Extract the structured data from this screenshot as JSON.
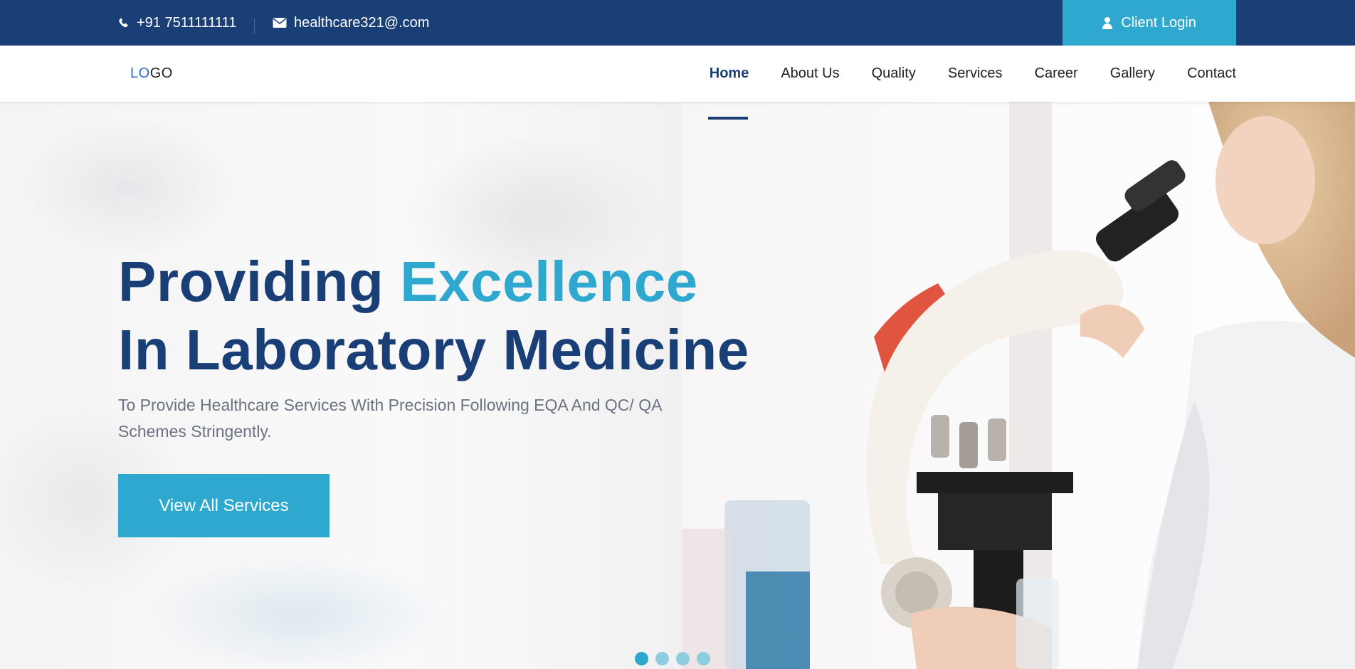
{
  "topbar": {
    "phone": "+91 7511111111",
    "email": "healthcare321@.com",
    "login_label": "Client Login"
  },
  "nav": {
    "logo_part1": "LO",
    "logo_part2": "GO",
    "items": [
      {
        "label": "Home",
        "active": true
      },
      {
        "label": "About Us"
      },
      {
        "label": "Quality"
      },
      {
        "label": "Services"
      },
      {
        "label": "Career"
      },
      {
        "label": "Gallery"
      },
      {
        "label": "Contact"
      }
    ]
  },
  "hero": {
    "title_part1": "Providing ",
    "title_accent": "Excellence",
    "title_line2": "In Laboratory Medicine",
    "subtitle": "To Provide Healthcare Services With Precision Following EQA And QC/ QA Schemes Stringently.",
    "cta_label": "View All Services",
    "slides": 4,
    "active_slide": 1
  },
  "colors": {
    "primary": "#1a3f77",
    "accent": "#2ea8cf",
    "text_muted": "#6b7280"
  },
  "icons": {
    "phone": "phone-icon",
    "email": "envelope-icon",
    "login": "user-icon"
  }
}
